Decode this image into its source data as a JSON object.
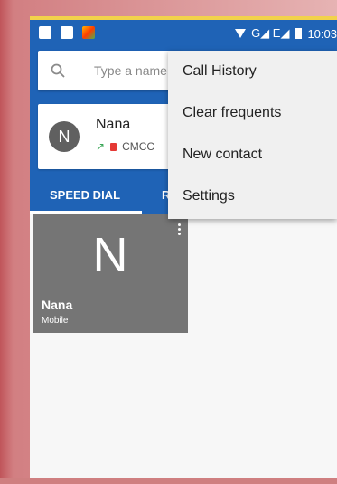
{
  "status_bar": {
    "network_text": "G◢ E◢",
    "time": "10:03"
  },
  "search": {
    "placeholder": "Type a name"
  },
  "recent_contact": {
    "avatar_letter": "N",
    "name": "Nana",
    "call_info": "CMCC"
  },
  "tabs": [
    {
      "label": "SPEED DIAL"
    },
    {
      "label": "R"
    }
  ],
  "speed_dial_tile": {
    "letter": "N",
    "name": "Nana",
    "type": "Mobile"
  },
  "overflow_menu": {
    "items": [
      {
        "label": "Call History"
      },
      {
        "label": "Clear frequents"
      },
      {
        "label": "New contact"
      },
      {
        "label": "Settings"
      }
    ]
  },
  "colors": {
    "accent_blue": "#1f63b6",
    "tile_gray": "#757575",
    "menu_bg": "#f0f0f0"
  }
}
